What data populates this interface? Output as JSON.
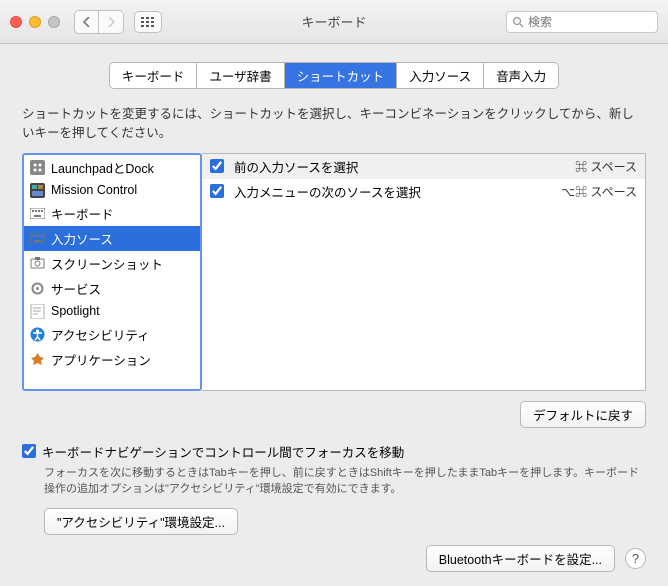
{
  "window": {
    "title": "キーボード"
  },
  "search": {
    "placeholder": "検索"
  },
  "tabs": [
    "キーボード",
    "ユーザ辞書",
    "ショートカット",
    "入力ソース",
    "音声入力"
  ],
  "active_tab": 2,
  "instruction": "ショートカットを変更するには、ショートカットを選択し、キーコンビネーションをクリックしてから、新しいキーを押してください。",
  "categories": [
    {
      "label": "LaunchpadとDock",
      "icon": "launchpad"
    },
    {
      "label": "Mission Control",
      "icon": "mission"
    },
    {
      "label": "キーボード",
      "icon": "keyboard"
    },
    {
      "label": "入力ソース",
      "icon": "keyboard",
      "selected": true
    },
    {
      "label": "スクリーンショット",
      "icon": "screenshot"
    },
    {
      "label": "サービス",
      "icon": "gear"
    },
    {
      "label": "Spotlight",
      "icon": "spotlight"
    },
    {
      "label": "アクセシビリティ",
      "icon": "accessibility"
    },
    {
      "label": "アプリケーション",
      "icon": "app"
    }
  ],
  "shortcuts": [
    {
      "checked": true,
      "label": "前の入力ソースを選択",
      "keys": "⌘ スペース",
      "highlight": true
    },
    {
      "checked": true,
      "label": "入力メニューの次のソースを選択",
      "keys": "⌥⌘ スペース"
    }
  ],
  "defaults_btn": "デフォルトに戻す",
  "keyboard_nav": {
    "checked": true,
    "label": "キーボードナビゲーションでコントロール間でフォーカスを移動",
    "desc": "フォーカスを次に移動するときはTabキーを押し、前に戻すときはShiftキーを押したままTabキーを押します。キーボード操作の追加オプションは\"アクセシビリティ\"環境設定で有効にできます。"
  },
  "accessibility_btn": "\"アクセシビリティ\"環境設定...",
  "bluetooth_btn": "Bluetoothキーボードを設定...",
  "help": "?"
}
